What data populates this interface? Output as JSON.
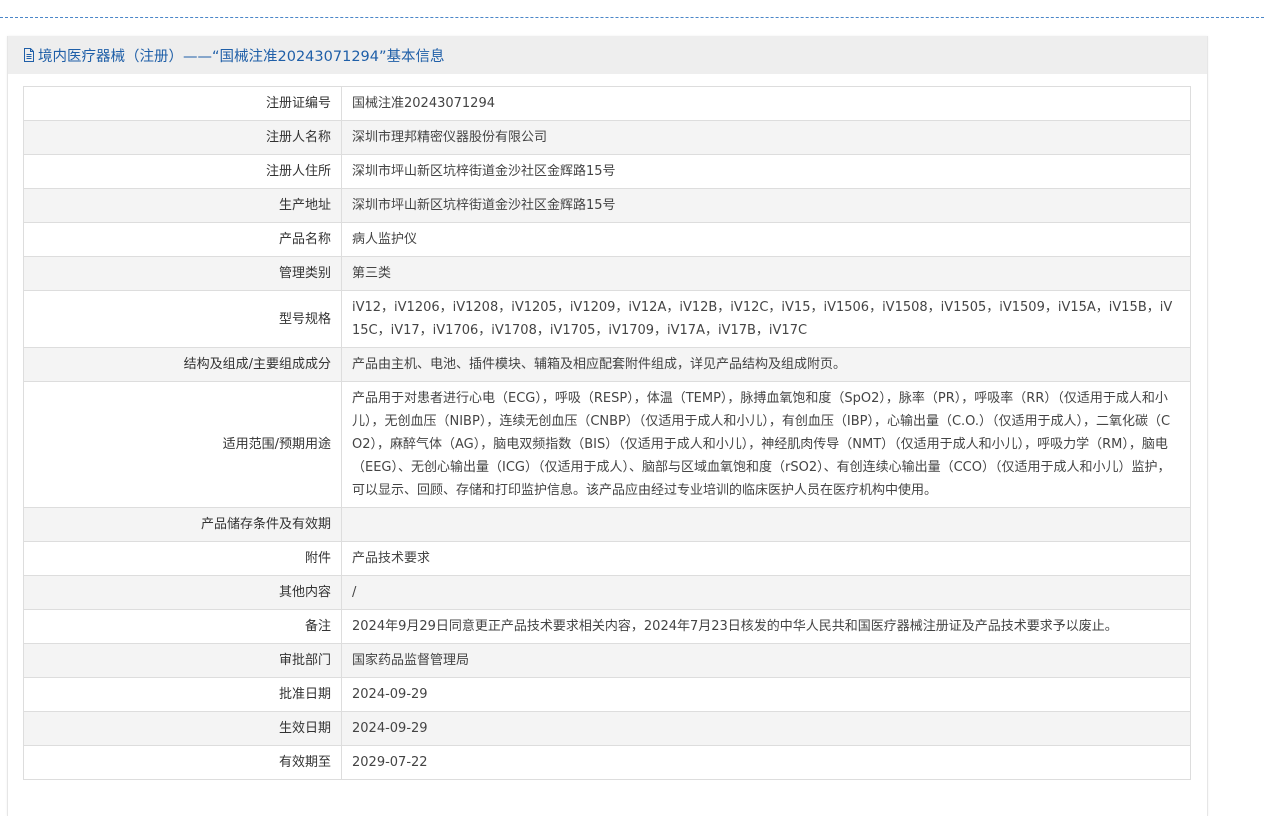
{
  "header": {
    "title": "境内医疗器械（注册）——“国械注准20243071294”基本信息",
    "icon": "document-icon"
  },
  "rows": [
    {
      "label": "注册证编号",
      "value": "国械注准20243071294"
    },
    {
      "label": "注册人名称",
      "value": "深圳市理邦精密仪器股份有限公司"
    },
    {
      "label": "注册人住所",
      "value": "深圳市坪山新区坑梓街道金沙社区金辉路15号"
    },
    {
      "label": "生产地址",
      "value": "深圳市坪山新区坑梓街道金沙社区金辉路15号"
    },
    {
      "label": "产品名称",
      "value": "病人监护仪"
    },
    {
      "label": "管理类别",
      "value": "第三类"
    },
    {
      "label": "型号规格",
      "value": "iV12，iV1206，iV1208，iV1205，iV1209，iV12A，iV12B，iV12C，iV15，iV1506，iV1508，iV1505，iV1509，iV15A，iV15B，iV15C，iV17，iV1706，iV1708，iV1705，iV1709，iV17A，iV17B，iV17C"
    },
    {
      "label": "结构及组成/主要组成成分",
      "value": "产品由主机、电池、插件模块、辅箱及相应配套附件组成，详见产品结构及组成附页。"
    },
    {
      "label": "适用范围/预期用途",
      "value": "产品用于对患者进行心电（ECG），呼吸（RESP），体温（TEMP），脉搏血氧饱和度（SpO2），脉率（PR），呼吸率（RR）（仅适用于成人和小儿），无创血压（NIBP），连续无创血压（CNBP）（仅适用于成人和小儿），有创血压（IBP），心输出量（C.O.）（仅适用于成人），二氧化碳（CO2），麻醉气体（AG），脑电双频指数（BIS）（仅适用于成人和小儿），神经肌肉传导（NMT）（仅适用于成人和小儿），呼吸力学（RM），脑电（EEG）、无创心输出量（ICG）（仅适用于成人）、脑部与区域血氧饱和度（rSO2）、有创连续心输出量（CCO）（仅适用于成人和小儿）监护，可以显示、回顾、存储和打印监护信息。该产品应由经过专业培训的临床医护人员在医疗机构中使用。"
    },
    {
      "label": "产品储存条件及有效期",
      "value": ""
    },
    {
      "label": "附件",
      "value": "产品技术要求"
    },
    {
      "label": "其他内容",
      "value": "/"
    },
    {
      "label": "备注",
      "value": "2024年9月29日同意更正产品技术要求相关内容，2024年7月23日核发的中华人民共和国医疗器械注册证及产品技术要求予以废止。"
    },
    {
      "label": "审批部门",
      "value": "国家药品监督管理局"
    },
    {
      "label": "批准日期",
      "value": "2024-09-29"
    },
    {
      "label": "生效日期",
      "value": "2024-09-29"
    },
    {
      "label": "有效期至",
      "value": "2029-07-22"
    }
  ],
  "colors": {
    "title": "#1f5fa8",
    "header_bg": "#eeeeee",
    "row_alt": "#f4f4f4",
    "border": "#dddddd",
    "dash": "#4a86c8"
  }
}
